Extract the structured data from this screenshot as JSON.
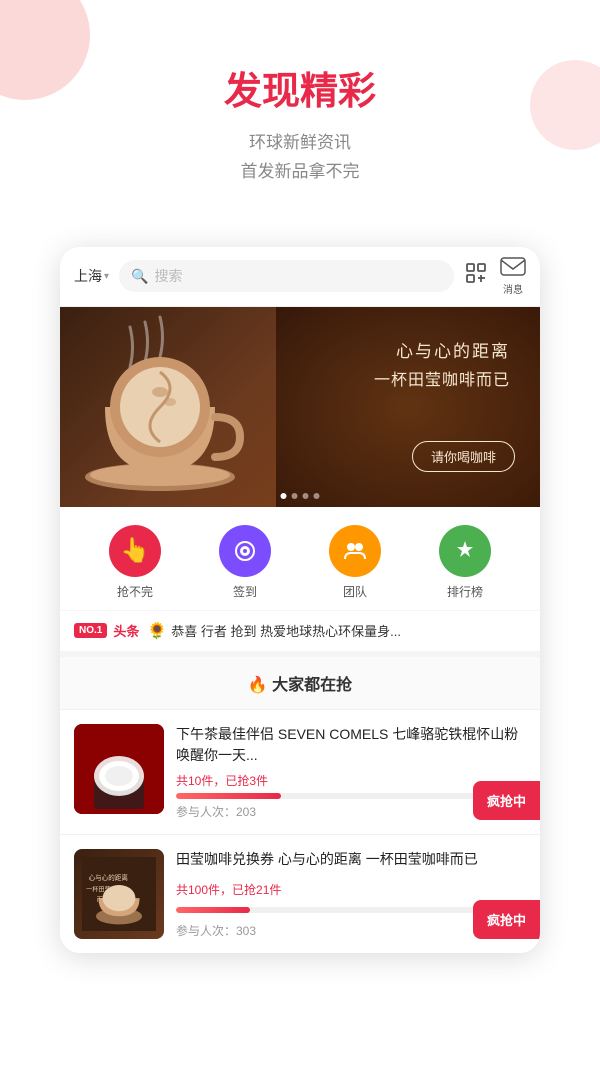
{
  "hero": {
    "title": "发现精彩",
    "subtitle_line1": "环球新鲜资讯",
    "subtitle_line2": "首发新品拿不完"
  },
  "search_bar": {
    "location": "上海",
    "search_placeholder": "搜索",
    "msg_label": "消息"
  },
  "banner": {
    "text_line1": "心与心的距离",
    "text_line2": "一杯田莹咖啡而已",
    "button_label": "请你喝咖啡",
    "dots": [
      true,
      false,
      false,
      false
    ]
  },
  "icons": [
    {
      "label": "抢不完",
      "color": "#e8294a",
      "symbol": "👆"
    },
    {
      "label": "签到",
      "color": "#7c4dff",
      "symbol": "🗄"
    },
    {
      "label": "团队",
      "color": "#ff9800",
      "symbol": "👥"
    },
    {
      "label": "排行榜",
      "color": "#4caf50",
      "symbol": "🏆"
    }
  ],
  "news": {
    "badge": "NO.1",
    "tag": "头条",
    "text": "恭喜 行者 抢到 热爱地球热心环保量身..."
  },
  "section": {
    "heading": "🔥 大家都在抢"
  },
  "products": [
    {
      "title": "下午茶最佳伴侣 SEVEN COMELS 七峰骆驼铁棍怀山粉 唤醒你一天...",
      "stock_text": "共10件，已抢3件",
      "progress": 30,
      "participants": "参与人次：203",
      "rush_label": "疯抢中"
    },
    {
      "title": "田莹咖啡兑换券 心与心的距离 一杯田莹咖啡而已",
      "stock_text": "共100件，已抢21件",
      "progress": 21,
      "participants": "参与人次：303",
      "rush_label": "疯抢中"
    }
  ]
}
